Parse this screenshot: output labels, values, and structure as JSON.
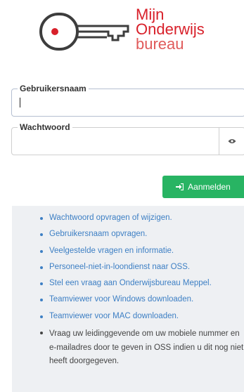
{
  "logo": {
    "line1": "Mijn",
    "line2": "Onderwijs",
    "line3": "bureau",
    "icon": "key-icon",
    "brand_red": "#d8202a",
    "key_stroke": "#3d3d3d"
  },
  "form": {
    "username": {
      "label": "Gebruikersnaam",
      "value": ""
    },
    "password": {
      "label": "Wachtwoord",
      "value": "",
      "toggle_icon": "eye-icon"
    },
    "login_button": {
      "label": "Aanmelden",
      "icon": "sign-in-icon",
      "color": "#28b463"
    }
  },
  "links": [
    "Wachtwoord opvragen of wijzigen.",
    "Gebruikersnaam opvragen.",
    "Veelgestelde vragen en informatie.",
    "Personeel-niet-in-loondienst naar OSS.",
    "Stel een vraag aan Onderwijsbureau Meppel.",
    "Teamviewer voor Windows downloaden.",
    "Teamviewer voor MAC downloaden."
  ],
  "note": "Vraag uw leidinggevende om uw mobiele nummer en e-mailadres door te geven in OSS indien u dit nog niet heeft doorgegeven.",
  "colors": {
    "link": "#3d7fc4",
    "panel_bg": "#eef0f3"
  }
}
